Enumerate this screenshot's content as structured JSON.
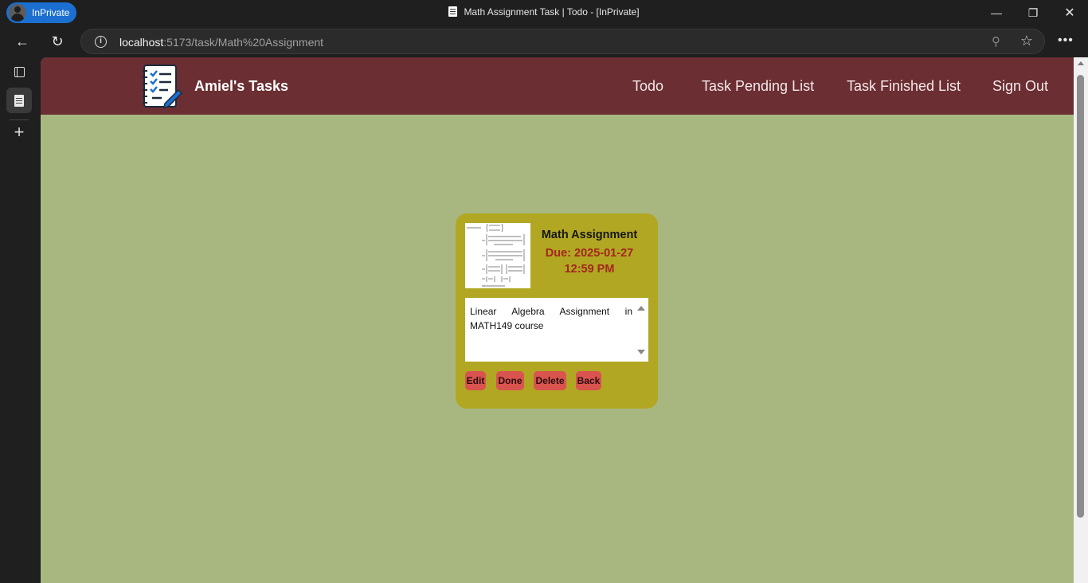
{
  "browser": {
    "profile_label": "InPrivate",
    "window_title": "Math Assignment Task | Todo - [InPrivate]",
    "url_host": "localhost",
    "url_path": ":5173/task/Math%20Assignment"
  },
  "header": {
    "brand": "Amiel's Tasks",
    "nav": [
      "Todo",
      "Task Pending List",
      "Task Finished List",
      "Sign Out"
    ]
  },
  "task": {
    "title": "Math Assignment",
    "due": "Due: 2025-01-27 12:59 PM",
    "description": "Linear Algebra Assignment in MATH149 course",
    "buttons": [
      "Edit",
      "Done",
      "Delete",
      "Back"
    ]
  },
  "colors": {
    "header_bg": "#6b2e32",
    "page_bg": "#a8b77f",
    "card_bg": "#b1a722",
    "due_text": "#a3261e",
    "button_bg": "#d9534f"
  }
}
